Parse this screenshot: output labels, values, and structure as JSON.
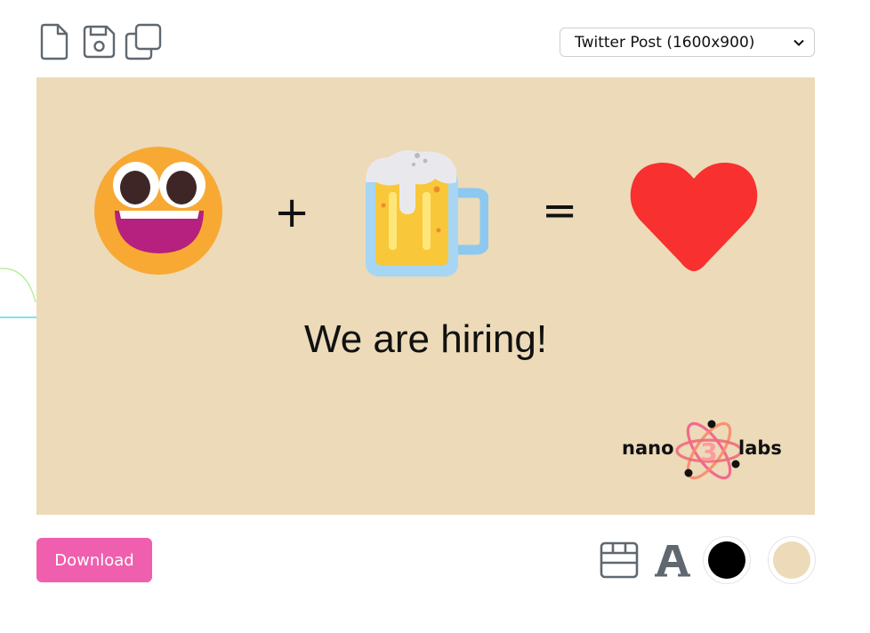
{
  "toolbar": {
    "new_icon": "new-file-icon",
    "save_icon": "save-icon",
    "duplicate_icon": "duplicate-icon"
  },
  "size_select": {
    "value": "Twitter Post (1600x900)"
  },
  "canvas": {
    "background": "#ecdab8",
    "plus": "+",
    "equals": "=",
    "headline": "We are hiring!",
    "emojis": [
      "grinning-face-icon",
      "beer-mug-icon",
      "red-heart-icon"
    ],
    "logo": {
      "left_text": "nano",
      "center_text": "3",
      "right_text": "labs"
    }
  },
  "bottom": {
    "download_label": "Download",
    "download_color": "#f05fae",
    "layout_icon": "layout-icon",
    "font_icon": "font-icon",
    "text_color": "#000000",
    "background_color": "#ecdab8"
  }
}
